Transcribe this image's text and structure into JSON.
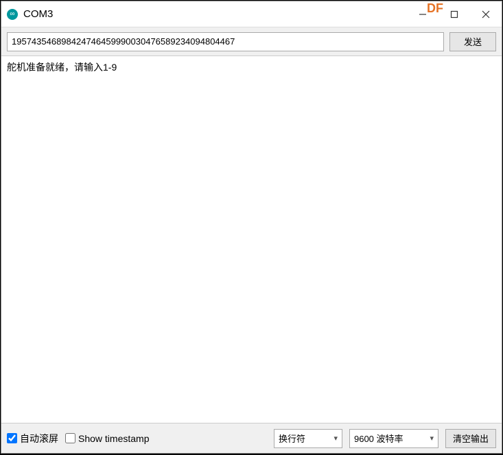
{
  "titlebar": {
    "title": "COM3",
    "overlay": "DF"
  },
  "toolbar": {
    "input_value": "195743546898424746459990030476589234094804467",
    "send_label": "发送"
  },
  "output": {
    "text": "舵机准备就绪，请输入1-9"
  },
  "statusbar": {
    "autoscroll_label": "自动滚屏",
    "autoscroll_checked": true,
    "timestamp_label": "Show timestamp",
    "timestamp_checked": false,
    "line_ending_selected": "换行符",
    "baud_selected": "9600 波特率",
    "clear_label": "清空输出"
  }
}
